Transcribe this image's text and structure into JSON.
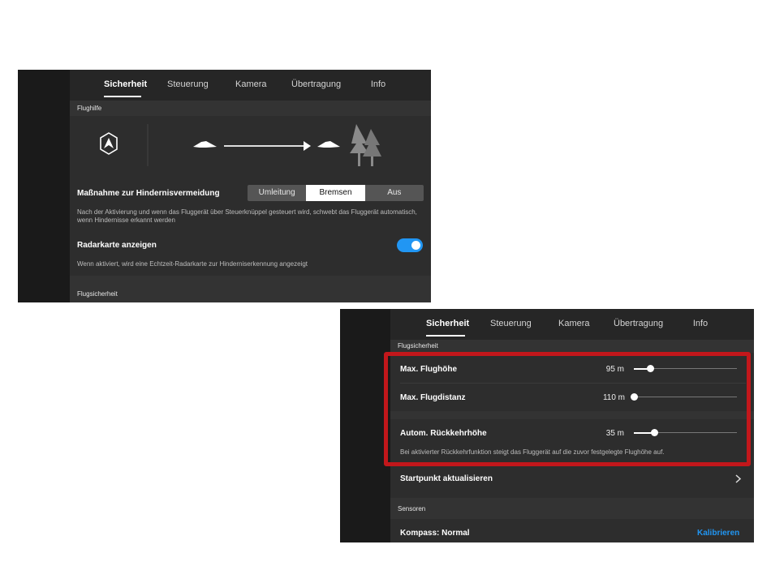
{
  "tabs": [
    "Sicherheit",
    "Steuerung",
    "Kamera",
    "Übertragung",
    "Info"
  ],
  "screen1": {
    "section_flughilfe": "Flughilfe",
    "obstacle_label": "Maßnahme zur Hindernisvermeidung",
    "obstacle_options": [
      "Umleitung",
      "Bremsen",
      "Aus"
    ],
    "obstacle_selected": "Bremsen",
    "obstacle_desc": "Nach der Aktivierung und wenn das Fluggerät über Steuerknüppel gesteuert wird, schwebt das Fluggerät automatisch, wenn Hindernisse erkannt werden",
    "radar_label": "Radarkarte anzeigen",
    "radar_on": true,
    "radar_desc": "Wenn aktiviert, wird eine Echtzeit-Radarkarte zur Hinderniserkennung angezeigt",
    "section_flugsicherheit": "Flugsicherheit"
  },
  "screen2": {
    "section_flugsicherheit": "Flugsicherheit",
    "max_height_label": "Max. Flughöhe",
    "max_height_value": "95 m",
    "max_height_fraction": 0.16,
    "max_distance_label": "Max. Flugdistanz",
    "max_distance_value": "110 m",
    "max_distance_fraction": 0.0,
    "rth_label": "Autom. Rückkehrhöhe",
    "rth_value": "35 m",
    "rth_fraction": 0.2,
    "rth_desc": "Bei aktivierter Rückkehrfunktion steigt das Fluggerät auf die zuvor festgelegte Flughöhe auf.",
    "home_label": "Startpunkt aktualisieren",
    "section_sensoren": "Sensoren",
    "compass_label": "Kompass: Normal",
    "calibrate_label": "Kalibrieren"
  },
  "colors": {
    "accent": "#2196f3",
    "highlight": "#c2171b"
  },
  "icons": [
    "drone-obstacle-icon",
    "aircraft-icon",
    "arrow-right-icon",
    "tree-icon",
    "chevron-right-icon"
  ]
}
